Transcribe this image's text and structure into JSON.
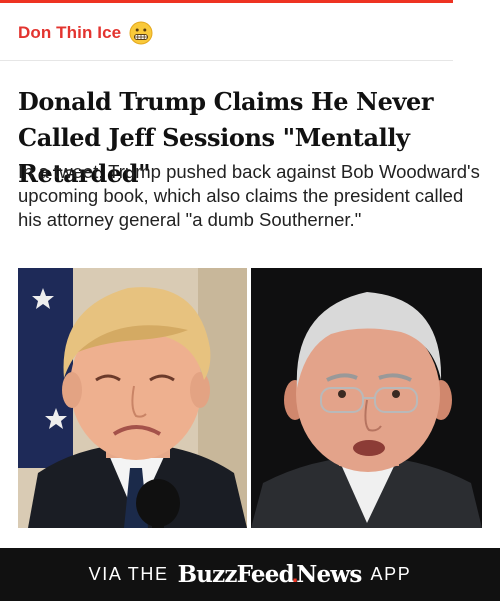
{
  "section": {
    "label": "Don Thin Ice",
    "icon": "grimacing-face-icon"
  },
  "article": {
    "headline": "Donald Trump Claims He Never Called Jeff Sessions \"Mentally Retarded\"",
    "dek": "In a tweet, Trump pushed back against Bob Woodward's upcoming book, which also claims the president called his attorney general \"a dumb Southerner.\""
  },
  "footer": {
    "via": "VIA THE",
    "brand_buzz": "BuzzFeed",
    "brand_news": "News",
    "app": "APP"
  },
  "colors": {
    "accent": "#e3342f",
    "footer_bg": "#111111"
  }
}
